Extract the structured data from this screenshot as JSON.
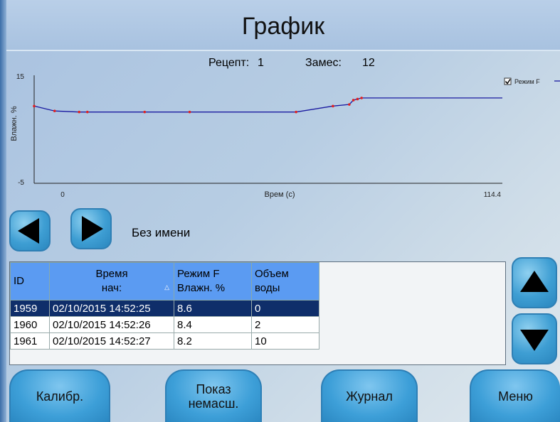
{
  "header": {
    "title": "График"
  },
  "recipe": {
    "label": "Рецепт:",
    "value": "1"
  },
  "batch": {
    "label": "Замес:",
    "value": "12"
  },
  "chart_data": {
    "type": "line",
    "ylabel": "Влажн. %",
    "xlabel": "Врем (с)",
    "ylim": [
      -5,
      15
    ],
    "xlim": [
      0,
      114.4
    ],
    "y_ticks": [
      "15",
      "-5"
    ],
    "x_ticks": [
      "0",
      "114.4"
    ],
    "legend": {
      "label": "Режим F",
      "checked": true,
      "placement": "top-right"
    },
    "series": [
      {
        "name": "Режим F",
        "color": "#1a1aa0",
        "x": [
          0,
          5,
          11,
          13,
          27,
          38,
          64,
          73,
          77,
          78,
          79,
          80,
          114.4
        ],
        "y": [
          9.3,
          8.4,
          8.2,
          8.2,
          8.2,
          8.2,
          8.2,
          9.3,
          9.6,
          10.4,
          10.6,
          10.8,
          10.8
        ],
        "markers_x": [
          0,
          5,
          11,
          13,
          27,
          38,
          64,
          73,
          77,
          78,
          79,
          80
        ],
        "marker_color": "#e02020"
      }
    ]
  },
  "nav": {
    "label": "Без имени"
  },
  "table": {
    "headers": [
      {
        "line1": "ID",
        "line2": ""
      },
      {
        "line1": "Время",
        "line2": "нач:"
      },
      {
        "line1": "Режим F",
        "line2": "Влажн. %"
      },
      {
        "line1": "Объем",
        "line2": "воды"
      }
    ],
    "rows": [
      {
        "id": "1959",
        "time": "02/10/2015 14:52:25",
        "mode": "8.6",
        "vol": "0",
        "selected": true
      },
      {
        "id": "1960",
        "time": "02/10/2015 14:52:26",
        "mode": "8.4",
        "vol": "2",
        "selected": false
      },
      {
        "id": "1961",
        "time": "02/10/2015 14:52:27",
        "mode": "8.2",
        "vol": "10",
        "selected": false
      }
    ]
  },
  "buttons": {
    "calib": "Калибр.",
    "show_line1": "Показ",
    "show_line2": "немасш.",
    "journal": "Журнал",
    "menu": "Меню"
  }
}
